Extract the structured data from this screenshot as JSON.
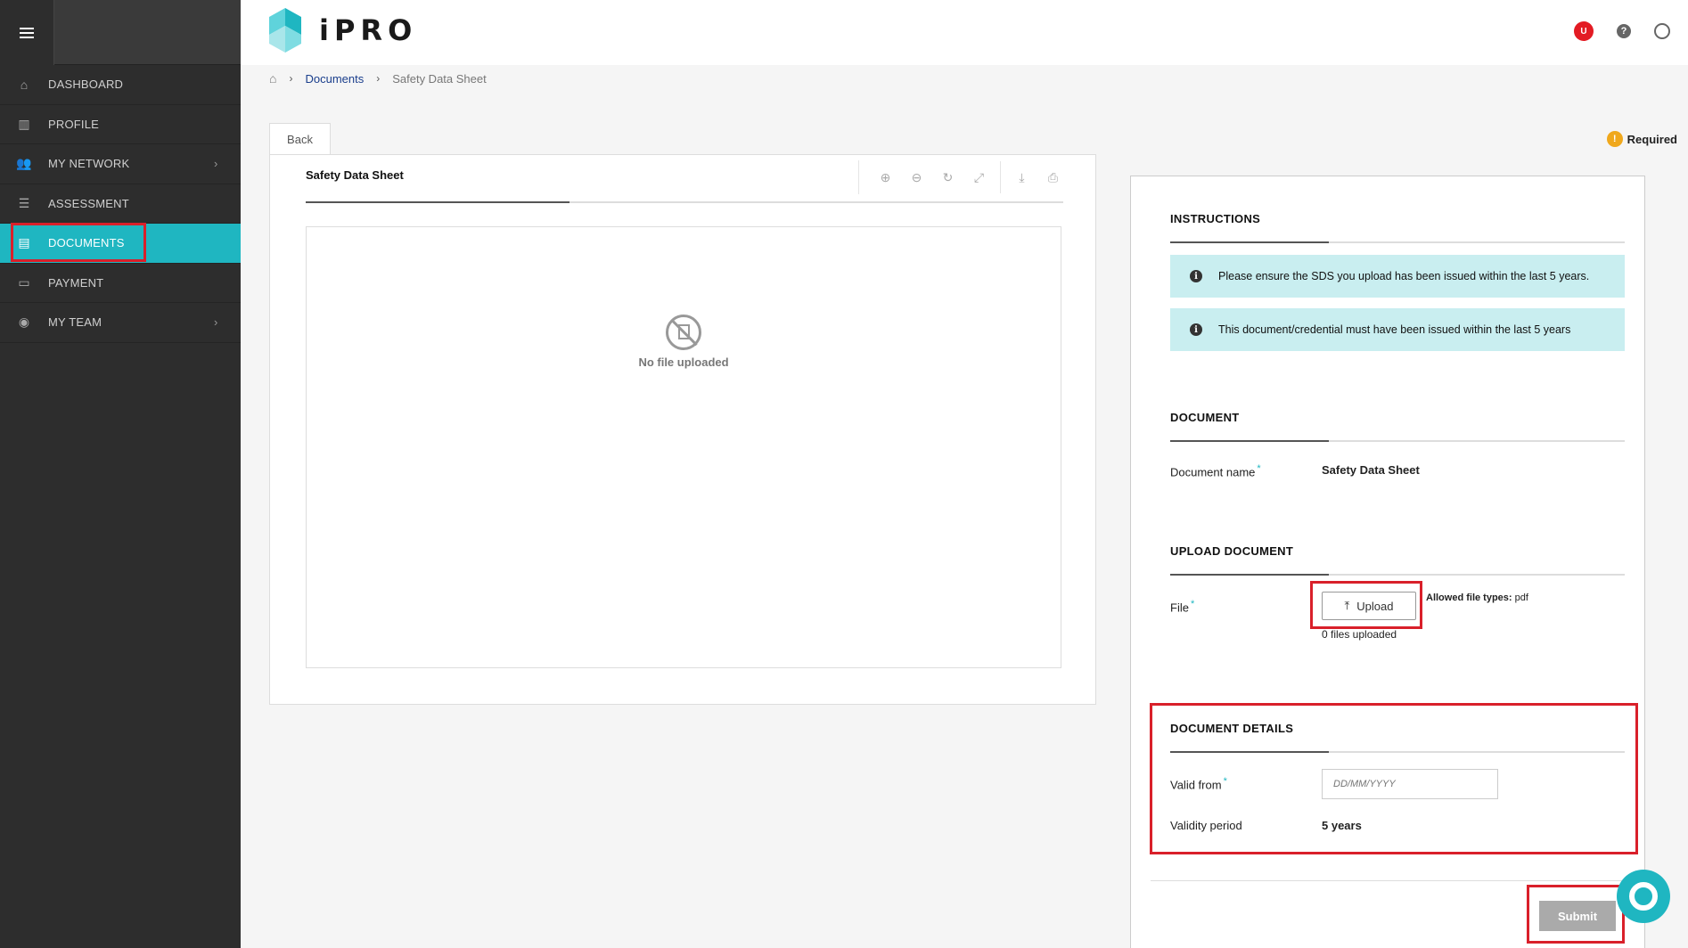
{
  "app": {
    "logo_text": "iPRO"
  },
  "sidebar": {
    "items": [
      {
        "label": "DASHBOARD",
        "icon": "home-icon"
      },
      {
        "label": "PROFILE",
        "icon": "building-icon"
      },
      {
        "label": "MY NETWORK",
        "icon": "users-icon",
        "chevron": "›"
      },
      {
        "label": "ASSESSMENT",
        "icon": "list-icon"
      },
      {
        "label": "DOCUMENTS",
        "icon": "document-icon"
      },
      {
        "label": "PAYMENT",
        "icon": "credit-card-icon"
      },
      {
        "label": "MY TEAM",
        "icon": "user-circle-icon",
        "chevron": "›"
      }
    ],
    "active": "DOCUMENTS"
  },
  "header": {
    "notification_count": "U",
    "help_glyph": "?"
  },
  "breadcrumb": {
    "sep": "›",
    "link": "Documents",
    "current": "Safety Data Sheet"
  },
  "back_label": "Back",
  "viewer": {
    "title": "Safety Data Sheet",
    "empty_text": "No file uploaded"
  },
  "required_label": "Required",
  "required_glyph": "!",
  "form": {
    "instructions": {
      "title": "INSTRUCTIONS",
      "items": [
        "Please ensure the SDS you upload has been issued within the last 5 years.",
        "This document/credential must have been issued within the last 5 years"
      ],
      "info_glyph": "i"
    },
    "document": {
      "title": "DOCUMENT",
      "name_label": "Document name",
      "name_value": "Safety Data Sheet"
    },
    "upload": {
      "title": "UPLOAD DOCUMENT",
      "file_label": "File",
      "button_label": "Upload",
      "allowed_label": "Allowed file types:",
      "allowed_value": "pdf",
      "count_text": "0 files uploaded"
    },
    "details": {
      "title": "DOCUMENT DETAILS",
      "valid_from_label": "Valid from",
      "valid_from_placeholder": "DD/MM/YYYY",
      "validity_label": "Validity period",
      "validity_value": "5 years"
    },
    "required_marker": "*",
    "submit_label": "Submit"
  },
  "colors": {
    "accent": "#1fb6c1",
    "sidebar": "#2d2d2d",
    "highlight": "#d9202a",
    "link": "#1a3e8c"
  }
}
